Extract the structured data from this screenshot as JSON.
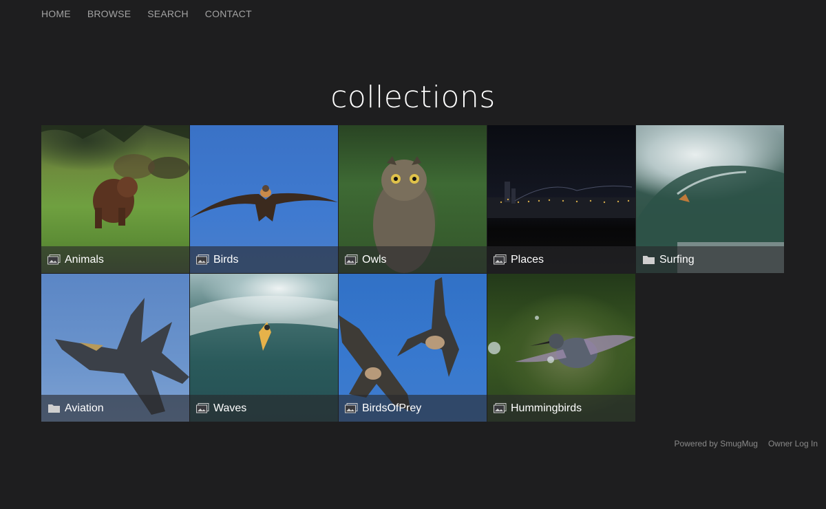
{
  "nav": [
    "HOME",
    "BROWSE",
    "SEARCH",
    "CONTACT"
  ],
  "page_title": "collections",
  "tiles": [
    {
      "label": "Animals",
      "icon": "gallery-icon"
    },
    {
      "label": "Birds",
      "icon": "gallery-icon"
    },
    {
      "label": "Owls",
      "icon": "gallery-icon"
    },
    {
      "label": "Places",
      "icon": "gallery-icon"
    },
    {
      "label": "Surfing",
      "icon": "folder-icon"
    },
    {
      "label": "Aviation",
      "icon": "folder-icon"
    },
    {
      "label": "Waves",
      "icon": "gallery-icon"
    },
    {
      "label": "BirdsOfPrey",
      "icon": "gallery-icon"
    },
    {
      "label": "Hummingbirds",
      "icon": "gallery-icon"
    }
  ],
  "footer": {
    "powered": "Powered by SmugMug",
    "login": "Owner Log In"
  },
  "colors": {
    "background": "#1e1e1f",
    "nav_text": "#a3a3a3",
    "caption_bg": "#28282c",
    "footer_text": "#8a8a8a"
  }
}
